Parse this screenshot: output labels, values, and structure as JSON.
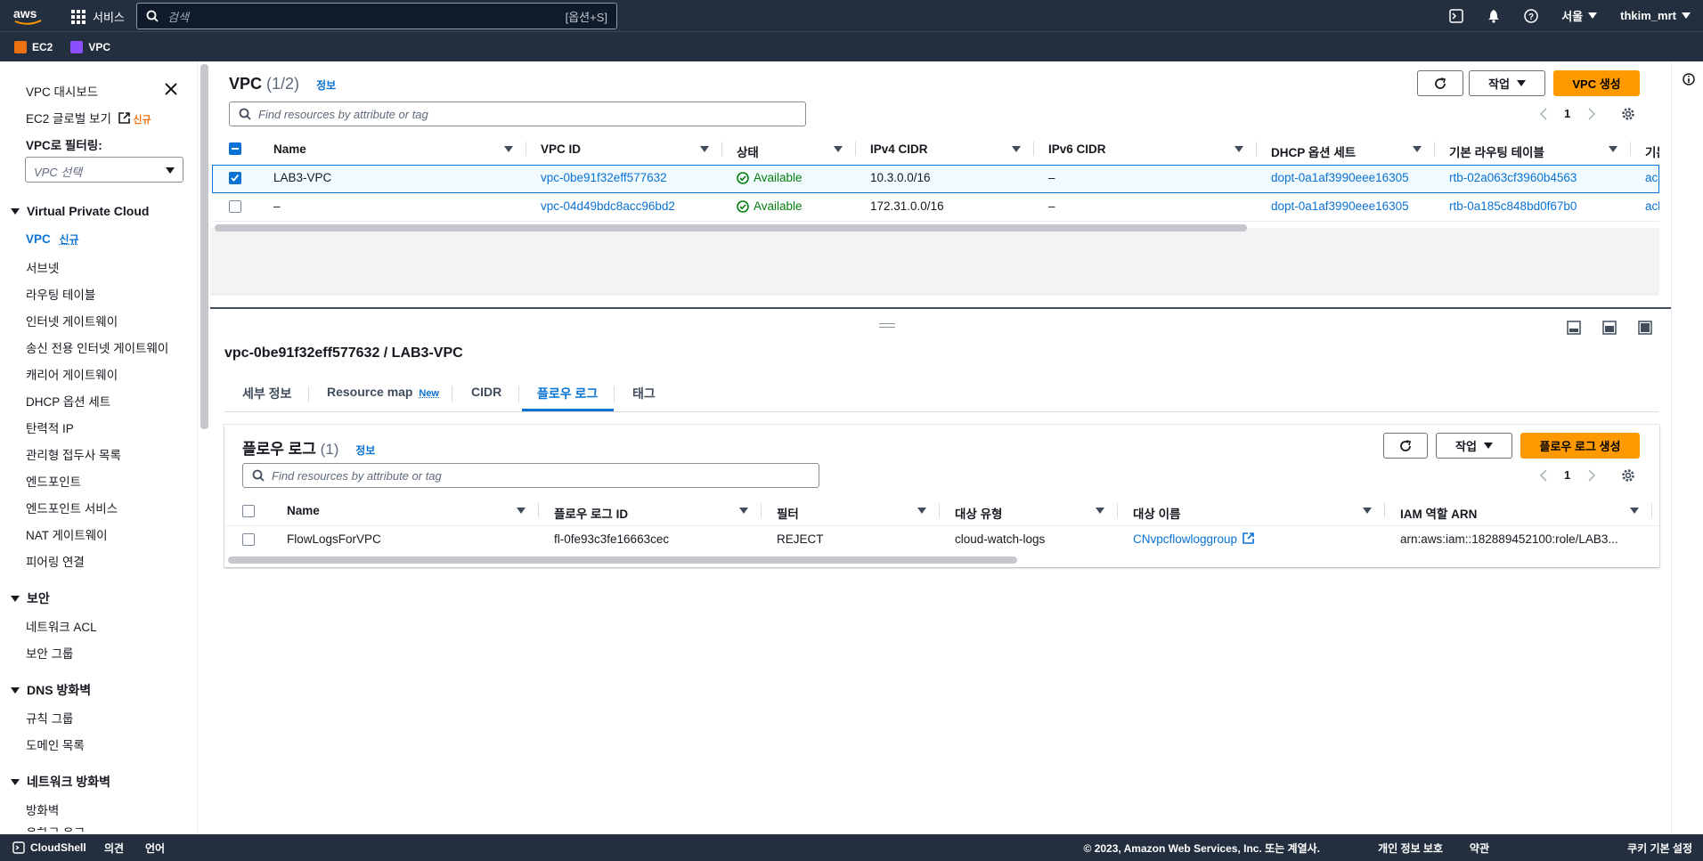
{
  "topbar": {
    "services": "서비스",
    "search_placeholder": "검색",
    "search_kbd": "[옵션+S]",
    "region": "서울",
    "user": "thkim_mrt"
  },
  "favorites": [
    {
      "label": "EC2",
      "color": "#ec7211"
    },
    {
      "label": "VPC",
      "color": "#8c4fff"
    }
  ],
  "sidebar": {
    "dashboard": "VPC 대시보드",
    "ec2_global": "EC2 글로벌 보기",
    "new": "신규",
    "filter_label": "VPC로 필터링:",
    "filter_placeholder": "VPC 선택",
    "groups": [
      {
        "title": "Virtual Private Cloud",
        "items": [
          "VPC",
          "서브넷",
          "라우팅 테이블",
          "인터넷 게이트웨이",
          "송신 전용 인터넷 게이트웨이",
          "캐리어 게이트웨이",
          "DHCP 옵션 세트",
          "탄력적 IP",
          "관리형 접두사 목록",
          "엔드포인트",
          "엔드포인트 서비스",
          "NAT 게이트웨이",
          "피어링 연결"
        ]
      },
      {
        "title": "보안",
        "items": [
          "네트워크 ACL",
          "보안 그룹"
        ]
      },
      {
        "title": "DNS 방화벽",
        "items": [
          "규칙 그룹",
          "도메인 목록"
        ]
      },
      {
        "title": "네트워크 방화벽",
        "items": [
          "방화벽",
          "방화벽 정책"
        ]
      }
    ]
  },
  "vpc_panel": {
    "title": "VPC",
    "count": "(1/2)",
    "info": "정보",
    "actions": "작업",
    "create": "VPC 생성",
    "filter_placeholder": "Find resources by attribute or tag",
    "page": "1",
    "columns": [
      "Name",
      "VPC ID",
      "상태",
      "IPv4 CIDR",
      "IPv6 CIDR",
      "DHCP 옵션 세트",
      "기본 라우팅 테이블",
      "기본"
    ],
    "rows": [
      {
        "name": "LAB3-VPC",
        "vpc_id": "vpc-0be91f32eff577632",
        "state": "Available",
        "ipv4": "10.3.0.0/16",
        "ipv6": "–",
        "dhcp": "dopt-0a1af3990eee16305",
        "rtb": "rtb-02a063cf3960b4563",
        "acl": "acl"
      },
      {
        "name": "–",
        "vpc_id": "vpc-04d49bdc8acc96bd2",
        "state": "Available",
        "ipv4": "172.31.0.0/16",
        "ipv6": "–",
        "dhcp": "dopt-0a1af3990eee16305",
        "rtb": "rtb-0a185c848bd0f67b0",
        "acl": "acl"
      }
    ]
  },
  "detail": {
    "title": "vpc-0be91f32eff577632 / LAB3-VPC",
    "tabs": [
      "세부 정보",
      "Resource map",
      "CIDR",
      "플로우 로그",
      "태그"
    ],
    "tab_new": "New",
    "flow": {
      "title": "플로우 로그",
      "count": "(1)",
      "info": "정보",
      "actions": "작업",
      "create": "플로우 로그 생성",
      "filter_placeholder": "Find resources by attribute or tag",
      "page": "1",
      "columns": [
        "Name",
        "플로우 로그 ID",
        "필터",
        "대상 유형",
        "대상 이름",
        "IAM 역할 ARN"
      ],
      "rows": [
        {
          "name": "FlowLogsForVPC",
          "id": "fl-0fe93c3fe16663cec",
          "filter": "REJECT",
          "dest_type": "cloud-watch-logs",
          "dest_name": "CNvpcflowloggroup",
          "iam": "arn:aws:iam::182889452100:role/LAB3..."
        }
      ]
    }
  },
  "footer": {
    "cloudshell": "CloudShell",
    "feedback": "의견",
    "language": "언어",
    "copyright": "© 2023, Amazon Web Services, Inc. 또는 계열사.",
    "privacy": "개인 정보 보호",
    "terms": "약관",
    "cookies": "쿠키 기본 설정"
  }
}
